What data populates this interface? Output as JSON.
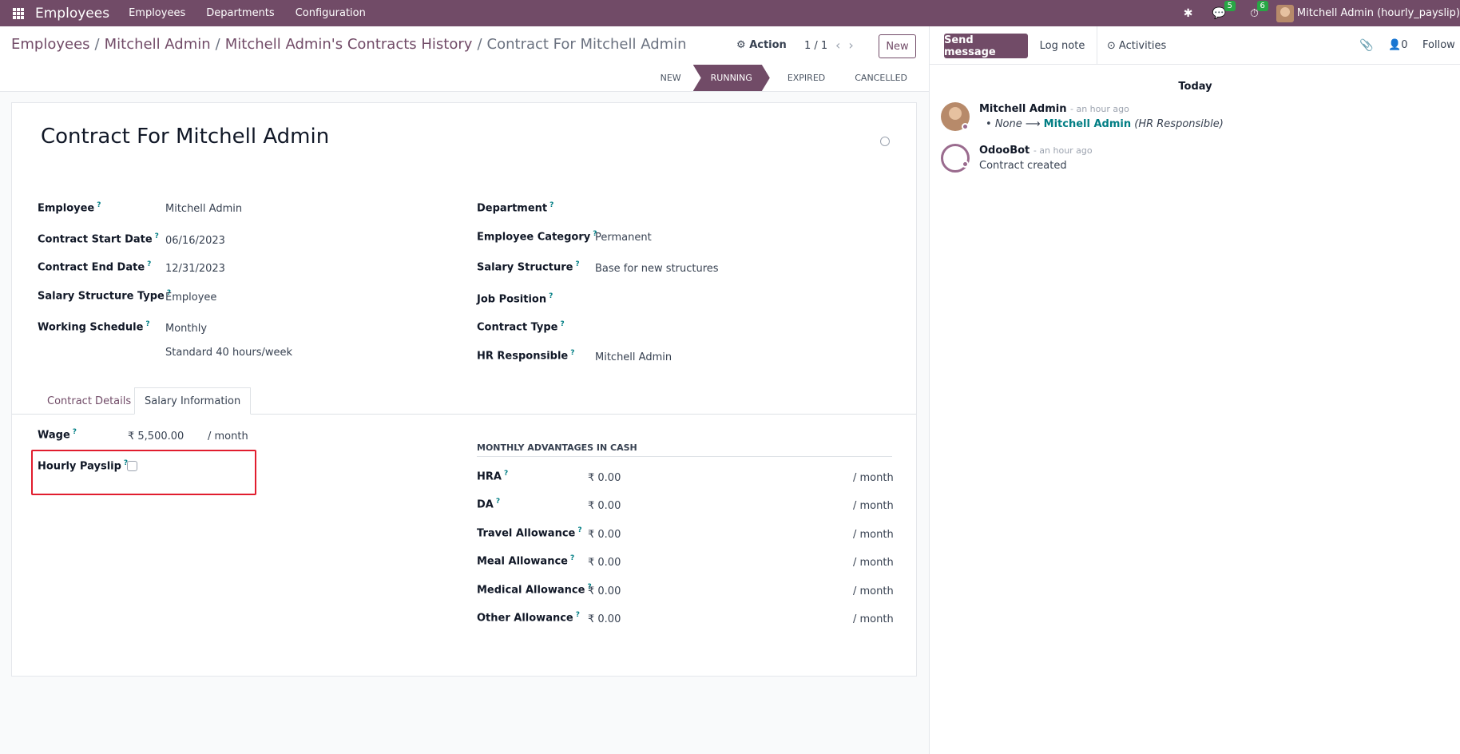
{
  "navbar": {
    "brand": "Employees",
    "menu": [
      "Employees",
      "Departments",
      "Configuration"
    ],
    "messages_count": "5",
    "activities_count": "6",
    "user": "Mitchell Admin (hourly_payslip)"
  },
  "breadcrumb": {
    "items": [
      "Employees",
      "Mitchell Admin",
      "Mitchell Admin's Contracts History"
    ],
    "current": "Contract For Mitchell Admin"
  },
  "toolbar": {
    "action_label": "Action",
    "pager": "1 / 1",
    "new_label": "New"
  },
  "statusbar": {
    "stages": [
      "NEW",
      "RUNNING",
      "EXPIRED",
      "CANCELLED"
    ],
    "active": "RUNNING"
  },
  "form": {
    "title": "Contract For Mitchell Admin",
    "left_fields": [
      {
        "label": "Employee",
        "value": "Mitchell Admin"
      },
      {
        "label": "Contract Start Date",
        "value": "06/16/2023"
      },
      {
        "label": "Contract End Date",
        "value": "12/31/2023"
      },
      {
        "label": "Salary Structure Type",
        "value": "Employee"
      },
      {
        "label": "Working Schedule",
        "value": "Monthly",
        "value2": "Standard 40 hours/week"
      }
    ],
    "right_fields": [
      {
        "label": "Department",
        "value": ""
      },
      {
        "label": "Employee Category",
        "value": "Permanent"
      },
      {
        "label": "Salary Structure",
        "value": "Base for new structures"
      },
      {
        "label": "Job Position",
        "value": ""
      },
      {
        "label": "Contract Type",
        "value": ""
      },
      {
        "label": "HR Responsible",
        "value": "Mitchell Admin"
      }
    ],
    "tabs": [
      "Contract Details",
      "Salary Information"
    ],
    "active_tab": "Salary Information",
    "wage": {
      "label": "Wage",
      "value": "₹ 5,500.00",
      "unit": "/ month"
    },
    "hourly_payslip": {
      "label": "Hourly Payslip",
      "checked": false
    },
    "advantages_title": "MONTHLY ADVANTAGES IN CASH",
    "allowances": [
      {
        "label": "HRA",
        "value": "₹ 0.00",
        "unit": "/ month"
      },
      {
        "label": "DA",
        "value": "₹ 0.00",
        "unit": "/ month"
      },
      {
        "label": "Travel Allowance",
        "value": "₹ 0.00",
        "unit": "/ month"
      },
      {
        "label": "Meal Allowance",
        "value": "₹ 0.00",
        "unit": "/ month"
      },
      {
        "label": "Medical Allowance",
        "value": "₹ 0.00",
        "unit": "/ month"
      },
      {
        "label": "Other Allowance",
        "value": "₹ 0.00",
        "unit": "/ month"
      }
    ]
  },
  "chatter": {
    "send_message": "Send message",
    "log_note": "Log note",
    "activities": "Activities",
    "followers_count": "0",
    "follow": "Follow",
    "date_separator": "Today",
    "messages": [
      {
        "author": "Mitchell Admin",
        "time": "- an hour ago",
        "old": "None",
        "new": "Mitchell Admin",
        "field": "(HR Responsible)"
      },
      {
        "author": "OdooBot",
        "time": "- an hour ago",
        "body": "Contract created"
      }
    ]
  },
  "colors": {
    "brand": "#714b67",
    "link": "#017e84",
    "highlight": "#e11d2e"
  }
}
